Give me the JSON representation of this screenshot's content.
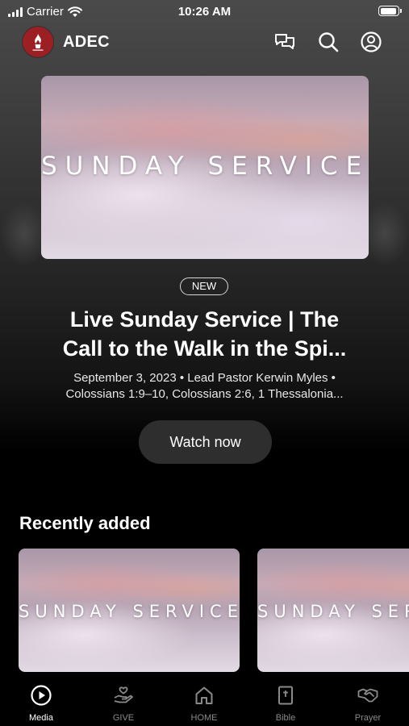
{
  "status_bar": {
    "carrier": "Carrier",
    "time": "10:26 AM",
    "battery_level": 0.95
  },
  "header": {
    "app_title": "ADEC",
    "icons": [
      "chat-icon",
      "search-icon",
      "profile-icon"
    ]
  },
  "hero": {
    "image_caption": "SUNDAY SERVICE",
    "badge": "NEW",
    "title_line1": "Live Sunday Service | The",
    "title_line2": "Call to the Walk in the Spi...",
    "meta_line1": "September 3, 2023 • Lead Pastor Kerwin Myles •",
    "meta_line2": "Colossians 1:9–10, Colossians 2:6, 1 Thessalonia...",
    "cta_label": "Watch now"
  },
  "recently_added": {
    "title": "Recently added",
    "items": [
      {
        "caption": "SUNDAY SERVICE"
      },
      {
        "caption": "SUNDAY SERVICE"
      }
    ]
  },
  "tab_bar": {
    "active": "Media",
    "tabs": [
      {
        "label": "Media",
        "icon": "play-circle-icon"
      },
      {
        "label": "GIVE",
        "icon": "giving-hand-icon"
      },
      {
        "label": "HOME",
        "icon": "home-icon"
      },
      {
        "label": "Bible",
        "icon": "bible-icon"
      },
      {
        "label": "Prayer",
        "icon": "prayer-handshake-icon"
      }
    ]
  },
  "colors": {
    "logo_red": "#9c1f24",
    "button_bg": "#2e2e2e",
    "inactive_tab": "#8a8a8a"
  }
}
